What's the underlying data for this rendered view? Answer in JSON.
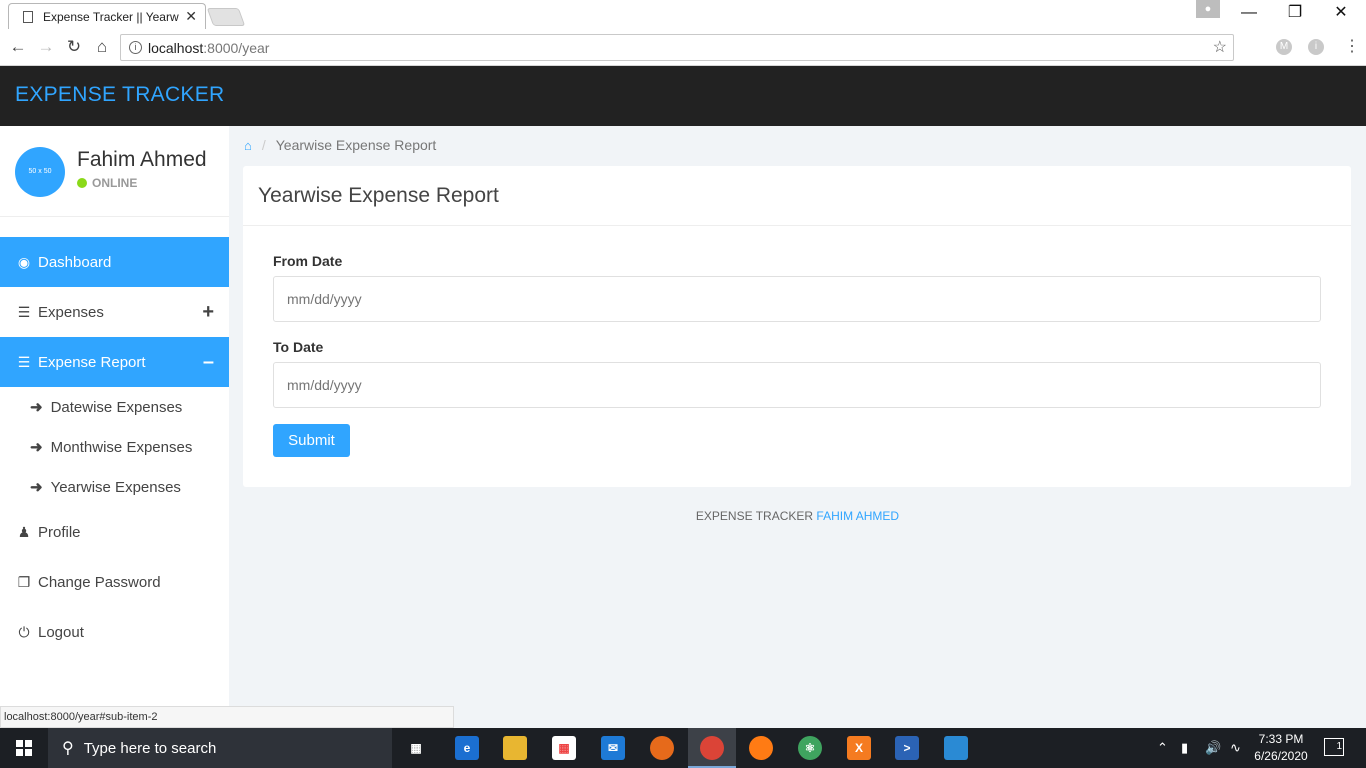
{
  "browser": {
    "tab_title": "Expense Tracker || Yearwise Expense Report",
    "tab_close": "✕",
    "url_host": "localhost",
    "url_path": ":8000/year",
    "profile_initial": "M",
    "status_url": "localhost:8000/year#sub-item-2"
  },
  "header": {
    "brand": "EXPENSE TRACKER"
  },
  "user": {
    "avatar_text": "50 x 50",
    "name": "Fahim Ahmed",
    "status": "ONLINE"
  },
  "sidebar": {
    "dashboard": "Dashboard",
    "expenses": "Expenses",
    "expense_report": "Expense Report",
    "sub_items": [
      "Datewise Expenses",
      "Monthwise Expenses",
      "Yearwise Expenses"
    ],
    "profile": "Profile",
    "change_password": "Change Password",
    "logout": "Logout"
  },
  "breadcrumb": {
    "current": "Yearwise Expense Report"
  },
  "panel": {
    "title": "Yearwise Expense Report",
    "from_label": "From Date",
    "from_placeholder": "mm/dd/yyyy",
    "to_label": "To Date",
    "to_placeholder": "mm/dd/yyyy",
    "submit_label": "Submit"
  },
  "footer": {
    "prefix": "EXPENSE TRACKER",
    "author": "FAHIM AHMED"
  },
  "taskbar": {
    "search_placeholder": "Type here to search",
    "time": "7:33 PM",
    "date": "6/26/2020",
    "notifications": "1"
  },
  "colors": {
    "accent": "#30a5ff",
    "header_bg": "#222222",
    "online": "#8ad919"
  }
}
